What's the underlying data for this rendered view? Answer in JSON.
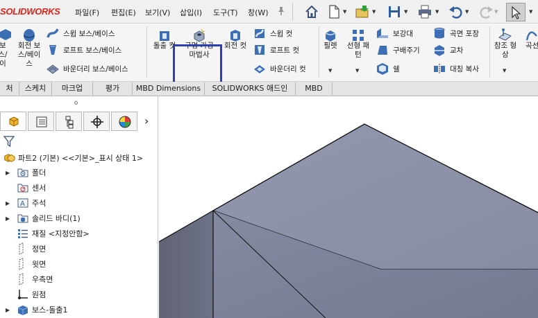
{
  "app": {
    "logo_prefix": "S",
    "logo_rest": "OLIDWORKS"
  },
  "menu": [
    {
      "label": "파일(F)"
    },
    {
      "label": "편집(E)"
    },
    {
      "label": "보기(V)"
    },
    {
      "label": "삽입(I)"
    },
    {
      "label": "도구(T)"
    },
    {
      "label": "창(W)"
    }
  ],
  "toolbar": {
    "pin_icon": "pin-icon",
    "quick_access": [
      "home-icon",
      "new-file-icon",
      "open-folder-icon",
      "save-icon",
      "print-icon",
      "undo-icon",
      "redo-icon",
      "select-cursor-icon"
    ]
  },
  "ribbon": {
    "boss_partial": "보\n스/\n이",
    "revolve_boss": "회전 보\n스/베이\n스",
    "sweep_boss": "스윕 보스/베이스",
    "loft_boss": "로프트 보스/베이스",
    "boundary_boss": "바운더리 보스/베이스",
    "extruded_cut": "돌출 컷",
    "hole_wizard": "구멍 가공\n마법사",
    "revolved_cut": "회전 컷",
    "swept_cut": "스윕 컷",
    "lofted_cut": "로프트 컷",
    "boundary_cut": "바운더리 컷",
    "fillet": "필렛",
    "linear_pattern": "선형 패\n턴",
    "rib": "보강대",
    "draft": "구배주기",
    "shell": "쉘",
    "wrap": "곡면 포장",
    "intersect": "교차",
    "mirror": "대칭 복사",
    "reference_geometry": "참조 형\n상",
    "curves_partial": "곡선"
  },
  "tabs": [
    {
      "label": "처"
    },
    {
      "label": "스케치"
    },
    {
      "label": "마크업"
    },
    {
      "label": "평가"
    },
    {
      "label": "MBD Dimensions"
    },
    {
      "label": "SOLIDWORKS 애드인"
    },
    {
      "label": "MBD"
    }
  ],
  "panel": {
    "tabs": [
      "feature-manager-icon",
      "property-manager-icon",
      "configuration-manager-icon",
      "dimxpert-icon",
      "display-manager-icon"
    ],
    "more_arrow": "›",
    "root_label": "파트2 (기본) <<기본>_표시 상태 1>",
    "tree": [
      {
        "label": "폴더",
        "icon": "history-folder-icon",
        "expandable": true
      },
      {
        "label": "센서",
        "icon": "sensor-icon",
        "expandable": false
      },
      {
        "label": "주석",
        "icon": "annotation-icon",
        "expandable": true
      },
      {
        "label": "솔리드 바디(1)",
        "icon": "solid-body-icon",
        "expandable": true
      },
      {
        "label": "재질 <지정안함>",
        "icon": "material-icon",
        "expandable": false
      },
      {
        "label": "정면",
        "icon": "plane-icon",
        "expandable": false
      },
      {
        "label": "윗면",
        "icon": "plane-icon",
        "expandable": false
      },
      {
        "label": "우측면",
        "icon": "plane-icon",
        "expandable": false
      },
      {
        "label": "원점",
        "icon": "origin-icon",
        "expandable": false
      },
      {
        "label": "보스-돌출1",
        "icon": "extrude-icon",
        "expandable": true
      }
    ]
  },
  "colors": {
    "accent_highlight": "#2b3fb0",
    "logo_red": "#d7261e",
    "model_top": "#8d93a9",
    "model_left": "#6c7083",
    "model_front": "#7b8096"
  }
}
